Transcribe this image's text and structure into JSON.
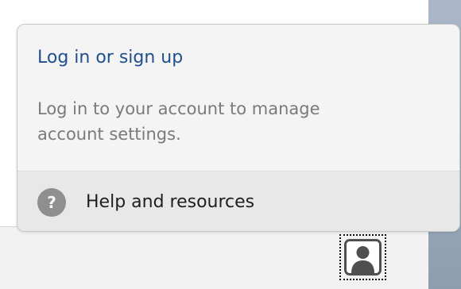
{
  "popover": {
    "login_link": "Log in or sign up",
    "description": "Log in to your account to manage account settings.",
    "help_label": "Help and resources",
    "help_icon_glyph": "?",
    "help_icon_name": "question-circle-icon"
  },
  "toolbar": {
    "avatar_icon_name": "user-avatar-icon"
  },
  "colors": {
    "link": "#1f4f8f",
    "description": "#7a7a7a",
    "help_row_background": "#e8e8e8",
    "right_strip": "#a9b7c9"
  }
}
